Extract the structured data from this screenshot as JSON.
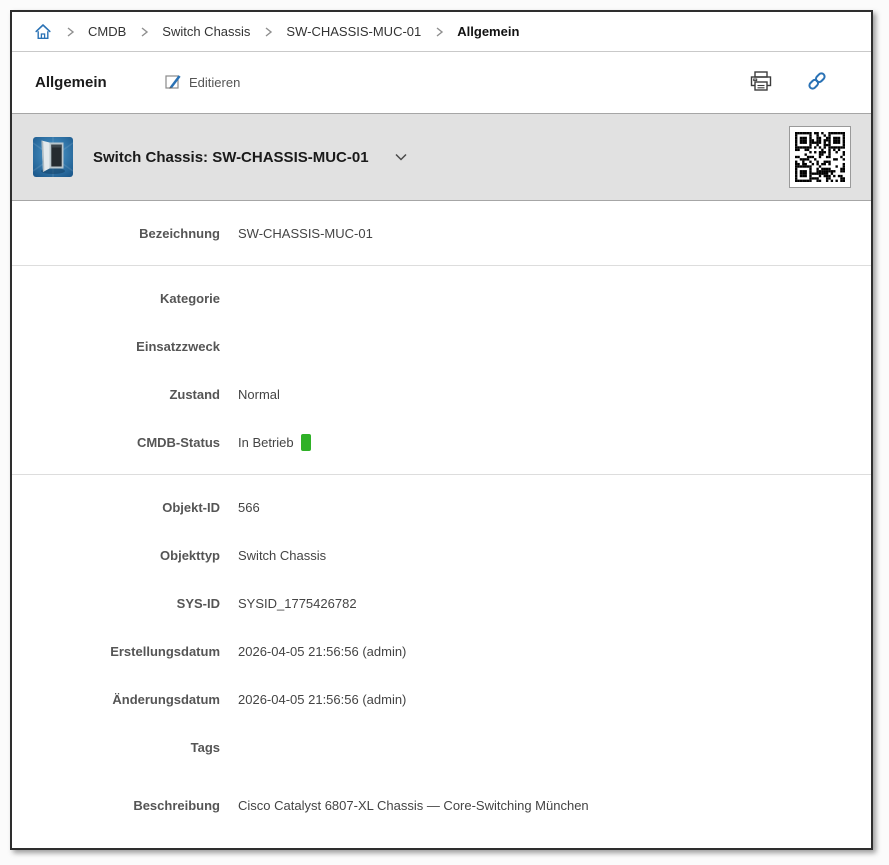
{
  "breadcrumb": {
    "items": [
      "CMDB",
      "Switch Chassis",
      "SW-CHASSIS-MUC-01",
      "Allgemein"
    ]
  },
  "toolbar": {
    "title": "Allgemein",
    "edit_label": "Editieren"
  },
  "object_header": {
    "title": "Switch Chassis: SW-CHASSIS-MUC-01"
  },
  "icons": {
    "home": "home-icon",
    "edit": "edit-pencil-icon",
    "print": "printer-icon",
    "link": "chain-link-icon",
    "caret": "chevron-down-icon",
    "object": "switch-chassis-image",
    "qr": "qr-code-image"
  },
  "colors": {
    "accent_blue": "#2a72b5",
    "status_green": "#2fb127",
    "band_gray": "#e1e1e1"
  },
  "form": {
    "sections": [
      {
        "rows": [
          {
            "label": "Bezeichnung",
            "value": "SW-CHASSIS-MUC-01"
          }
        ]
      },
      {
        "rows": [
          {
            "label": "Kategorie",
            "value": ""
          },
          {
            "label": "Einsatzzweck",
            "value": ""
          },
          {
            "label": "Zustand",
            "value": "Normal"
          },
          {
            "label": "CMDB-Status",
            "value": "In Betrieb",
            "badge": true
          }
        ]
      },
      {
        "rows": [
          {
            "label": "Objekt-ID",
            "value": "566"
          },
          {
            "label": "Objekttyp",
            "value": "Switch Chassis"
          },
          {
            "label": "SYS-ID",
            "value": "SYSID_1775426782"
          },
          {
            "label": "Erstellungsdatum",
            "value": "2026-04-05 21:56:56 (admin)"
          },
          {
            "label": "Änderungsdatum",
            "value": "2026-04-05 21:56:56 (admin)"
          },
          {
            "label": "Tags",
            "value": ""
          },
          {
            "label": "Beschreibung",
            "value": "Cisco Catalyst 6807-XL Chassis — Core-Switching München",
            "tall": true
          }
        ]
      }
    ]
  }
}
